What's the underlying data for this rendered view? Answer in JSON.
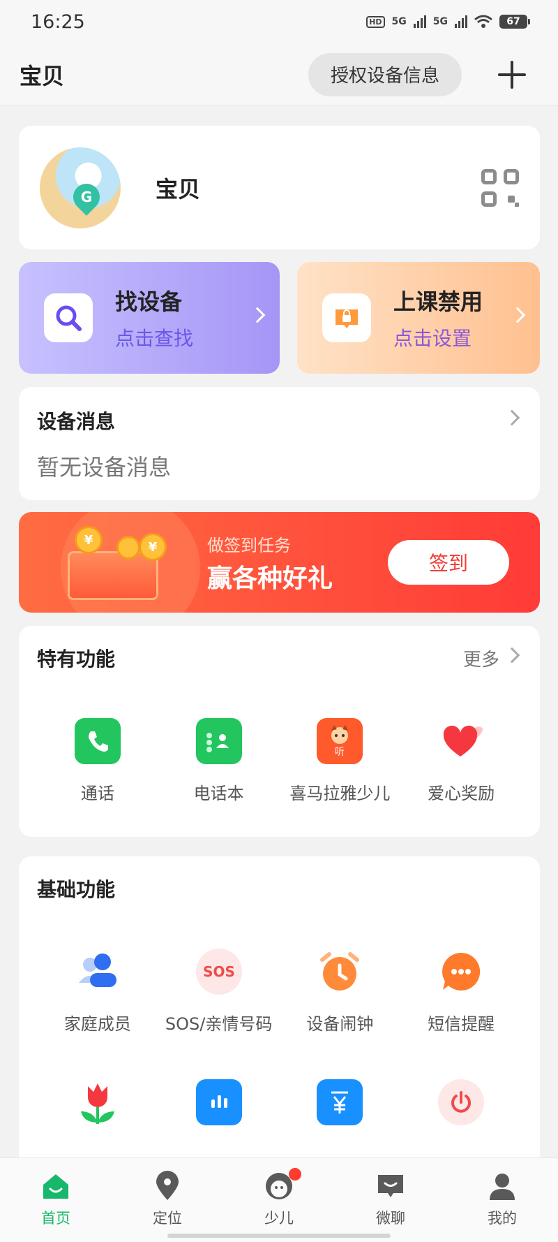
{
  "status": {
    "time": "16:25",
    "network_1": "5G",
    "network_2": "5G",
    "battery": "67"
  },
  "header": {
    "title": "宝贝",
    "auth_button": "授权设备信息"
  },
  "profile": {
    "name": "宝贝"
  },
  "actions": [
    {
      "title": "找设备",
      "subtitle": "点击查找"
    },
    {
      "title": "上课禁用",
      "subtitle": "点击设置"
    }
  ],
  "messages": {
    "title": "设备消息",
    "empty": "暂无设备消息"
  },
  "banner": {
    "subtitle": "做签到任务",
    "title": "赢各种好礼",
    "button": "签到"
  },
  "special": {
    "title": "特有功能",
    "more": "更多",
    "items": [
      {
        "label": "通话",
        "icon": "phone-icon",
        "color": "#22c55e"
      },
      {
        "label": "电话本",
        "icon": "contacts-icon",
        "color": "#22c55e"
      },
      {
        "label": "喜马拉雅少儿",
        "icon": "ximalaya-icon",
        "color": "#ff5a2c"
      },
      {
        "label": "爱心奖励",
        "icon": "heart-icon",
        "color": "#f5383f"
      }
    ]
  },
  "basic": {
    "title": "基础功能",
    "items": [
      {
        "label": "家庭成员",
        "icon": "family-icon",
        "color": "#2f6ef0"
      },
      {
        "label": "SOS/亲情号码",
        "icon": "sos-icon",
        "color": "#f04a4a"
      },
      {
        "label": "设备闹钟",
        "icon": "alarm-icon",
        "color": "#ff8a3a"
      },
      {
        "label": "短信提醒",
        "icon": "sms-icon",
        "color": "#ff7a2a"
      }
    ],
    "row2_icons": [
      "tulip-icon",
      "chart-monitor-icon",
      "yuan-icon",
      "power-icon"
    ]
  },
  "tabs": [
    {
      "label": "首页",
      "icon": "home-icon",
      "active": true
    },
    {
      "label": "定位",
      "icon": "location-icon",
      "active": false
    },
    {
      "label": "少儿",
      "icon": "kid-icon",
      "active": false
    },
    {
      "label": "微聊",
      "icon": "chat-icon",
      "active": false
    },
    {
      "label": "我的",
      "icon": "profile-icon",
      "active": false
    }
  ],
  "colors": {
    "accent_green": "#17b86b",
    "find_purple": "#a596f6",
    "class_orange": "#ffc090",
    "banner_red": "#ff3b37"
  }
}
